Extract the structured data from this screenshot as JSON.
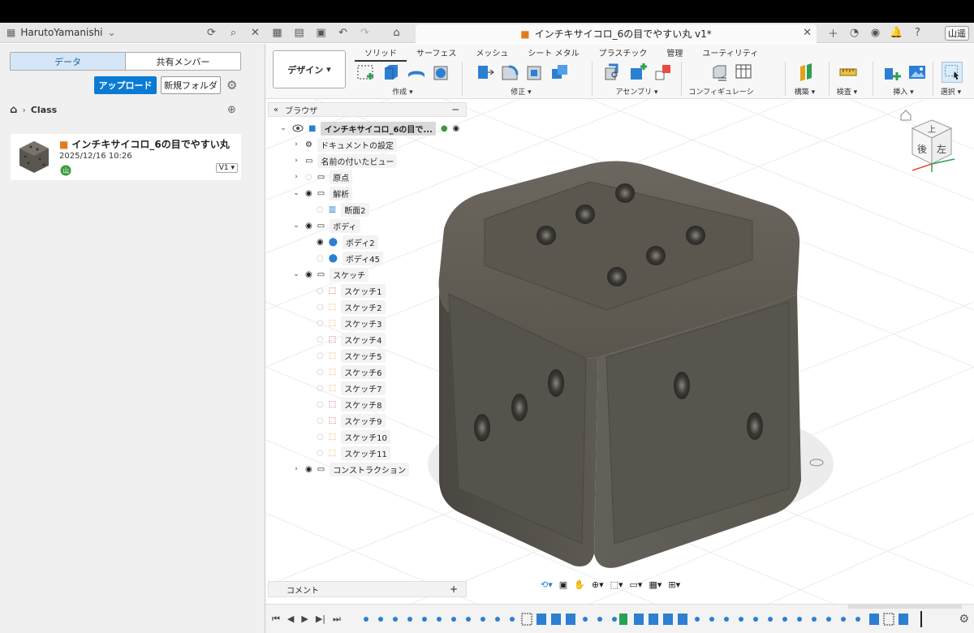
{
  "titlebar": {
    "user": "HarutoYamanishi",
    "doc_title": "インチキサイコロ_6の目でやすい丸 v1*",
    "user_badge": "山遥"
  },
  "data_panel": {
    "tab_data": "データ",
    "tab_members": "共有メンバー",
    "upload_label": "アップロード",
    "new_folder_label": "新規フォルダ",
    "breadcrumb": "Class",
    "file": {
      "name": "インチキサイコロ_6の目でやすい丸",
      "date": "2025/12/16 10:26",
      "version": "V1"
    }
  },
  "toolbar": {
    "workspace": "デザイン",
    "tabs": [
      "ソリッド",
      "サーフェス",
      "メッシュ",
      "シート メタル",
      "プラスチック",
      "管理",
      "ユーティリティ"
    ],
    "groups": [
      "作成",
      "修正",
      "アセンブリ",
      "コンフィギュレーション",
      "構築",
      "検査",
      "挿入",
      "選択"
    ]
  },
  "browser": {
    "title": "ブラウザ",
    "root": "インチキサイコロ_6の目で...",
    "items": [
      "ドキュメントの設定",
      "名前の付いたビュー",
      "原点",
      "解析",
      "断面2",
      "ボディ",
      "ボディ2",
      "ボディ45",
      "スケッチ",
      "スケッチ1",
      "スケッチ2",
      "スケッチ3",
      "スケッチ4",
      "スケッチ5",
      "スケッチ6",
      "スケッチ7",
      "スケッチ8",
      "スケッチ9",
      "スケッチ10",
      "スケッチ11",
      "コンストラクション"
    ]
  },
  "comments": {
    "label": "コメント"
  },
  "viewcube": {
    "top": "上",
    "front": "後",
    "right": "左"
  }
}
